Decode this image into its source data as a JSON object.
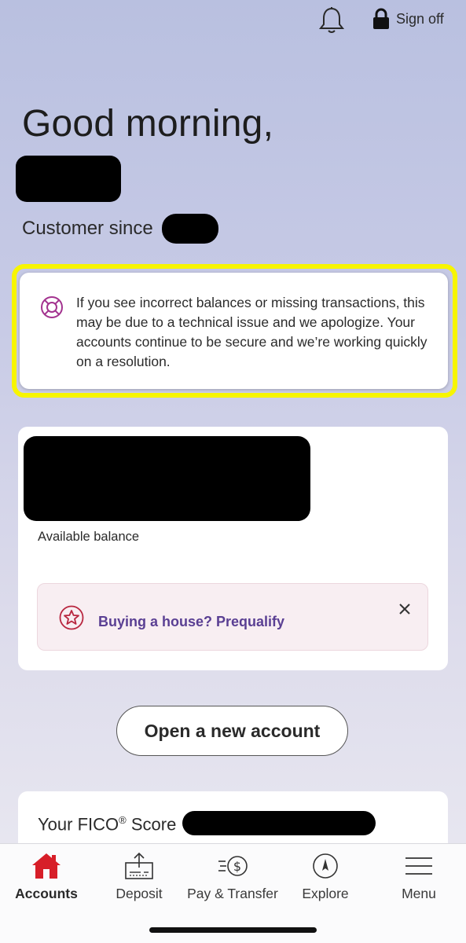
{
  "header": {
    "notifications_icon": "bell-icon",
    "sign_off_label": "Sign off",
    "sign_off_icon": "lock-icon"
  },
  "greeting": {
    "text": "Good morning,",
    "customer_since_label": "Customer since"
  },
  "notice": {
    "icon": "lifebuoy-icon",
    "message": "If you see incorrect balances or missing transactions, this may be due to a technical issue and we apologize. Your accounts continue to be secure and we’re working quickly on a resolution.",
    "highlight_color": "#f7f500"
  },
  "account_card": {
    "balance_caption": "Available balance",
    "promo": {
      "icon": "star-icon",
      "label": "Buying a house? Prequalify",
      "close_icon": "close-icon",
      "link_color": "#5a3f93"
    }
  },
  "open_account_label": "Open a new account",
  "fico": {
    "label_prefix": "Your FICO",
    "label_mark": "®",
    "label_suffix": " Score"
  },
  "tabs": [
    {
      "label": "Accounts",
      "icon": "home-icon",
      "active": true,
      "color": "#d71e28"
    },
    {
      "label": "Deposit",
      "icon": "deposit-check-icon",
      "active": false
    },
    {
      "label": "Pay & Transfer",
      "icon": "pay-transfer-icon",
      "active": false
    },
    {
      "label": "Explore",
      "icon": "compass-icon",
      "active": false
    },
    {
      "label": "Menu",
      "icon": "hamburger-menu-icon",
      "active": false
    }
  ]
}
